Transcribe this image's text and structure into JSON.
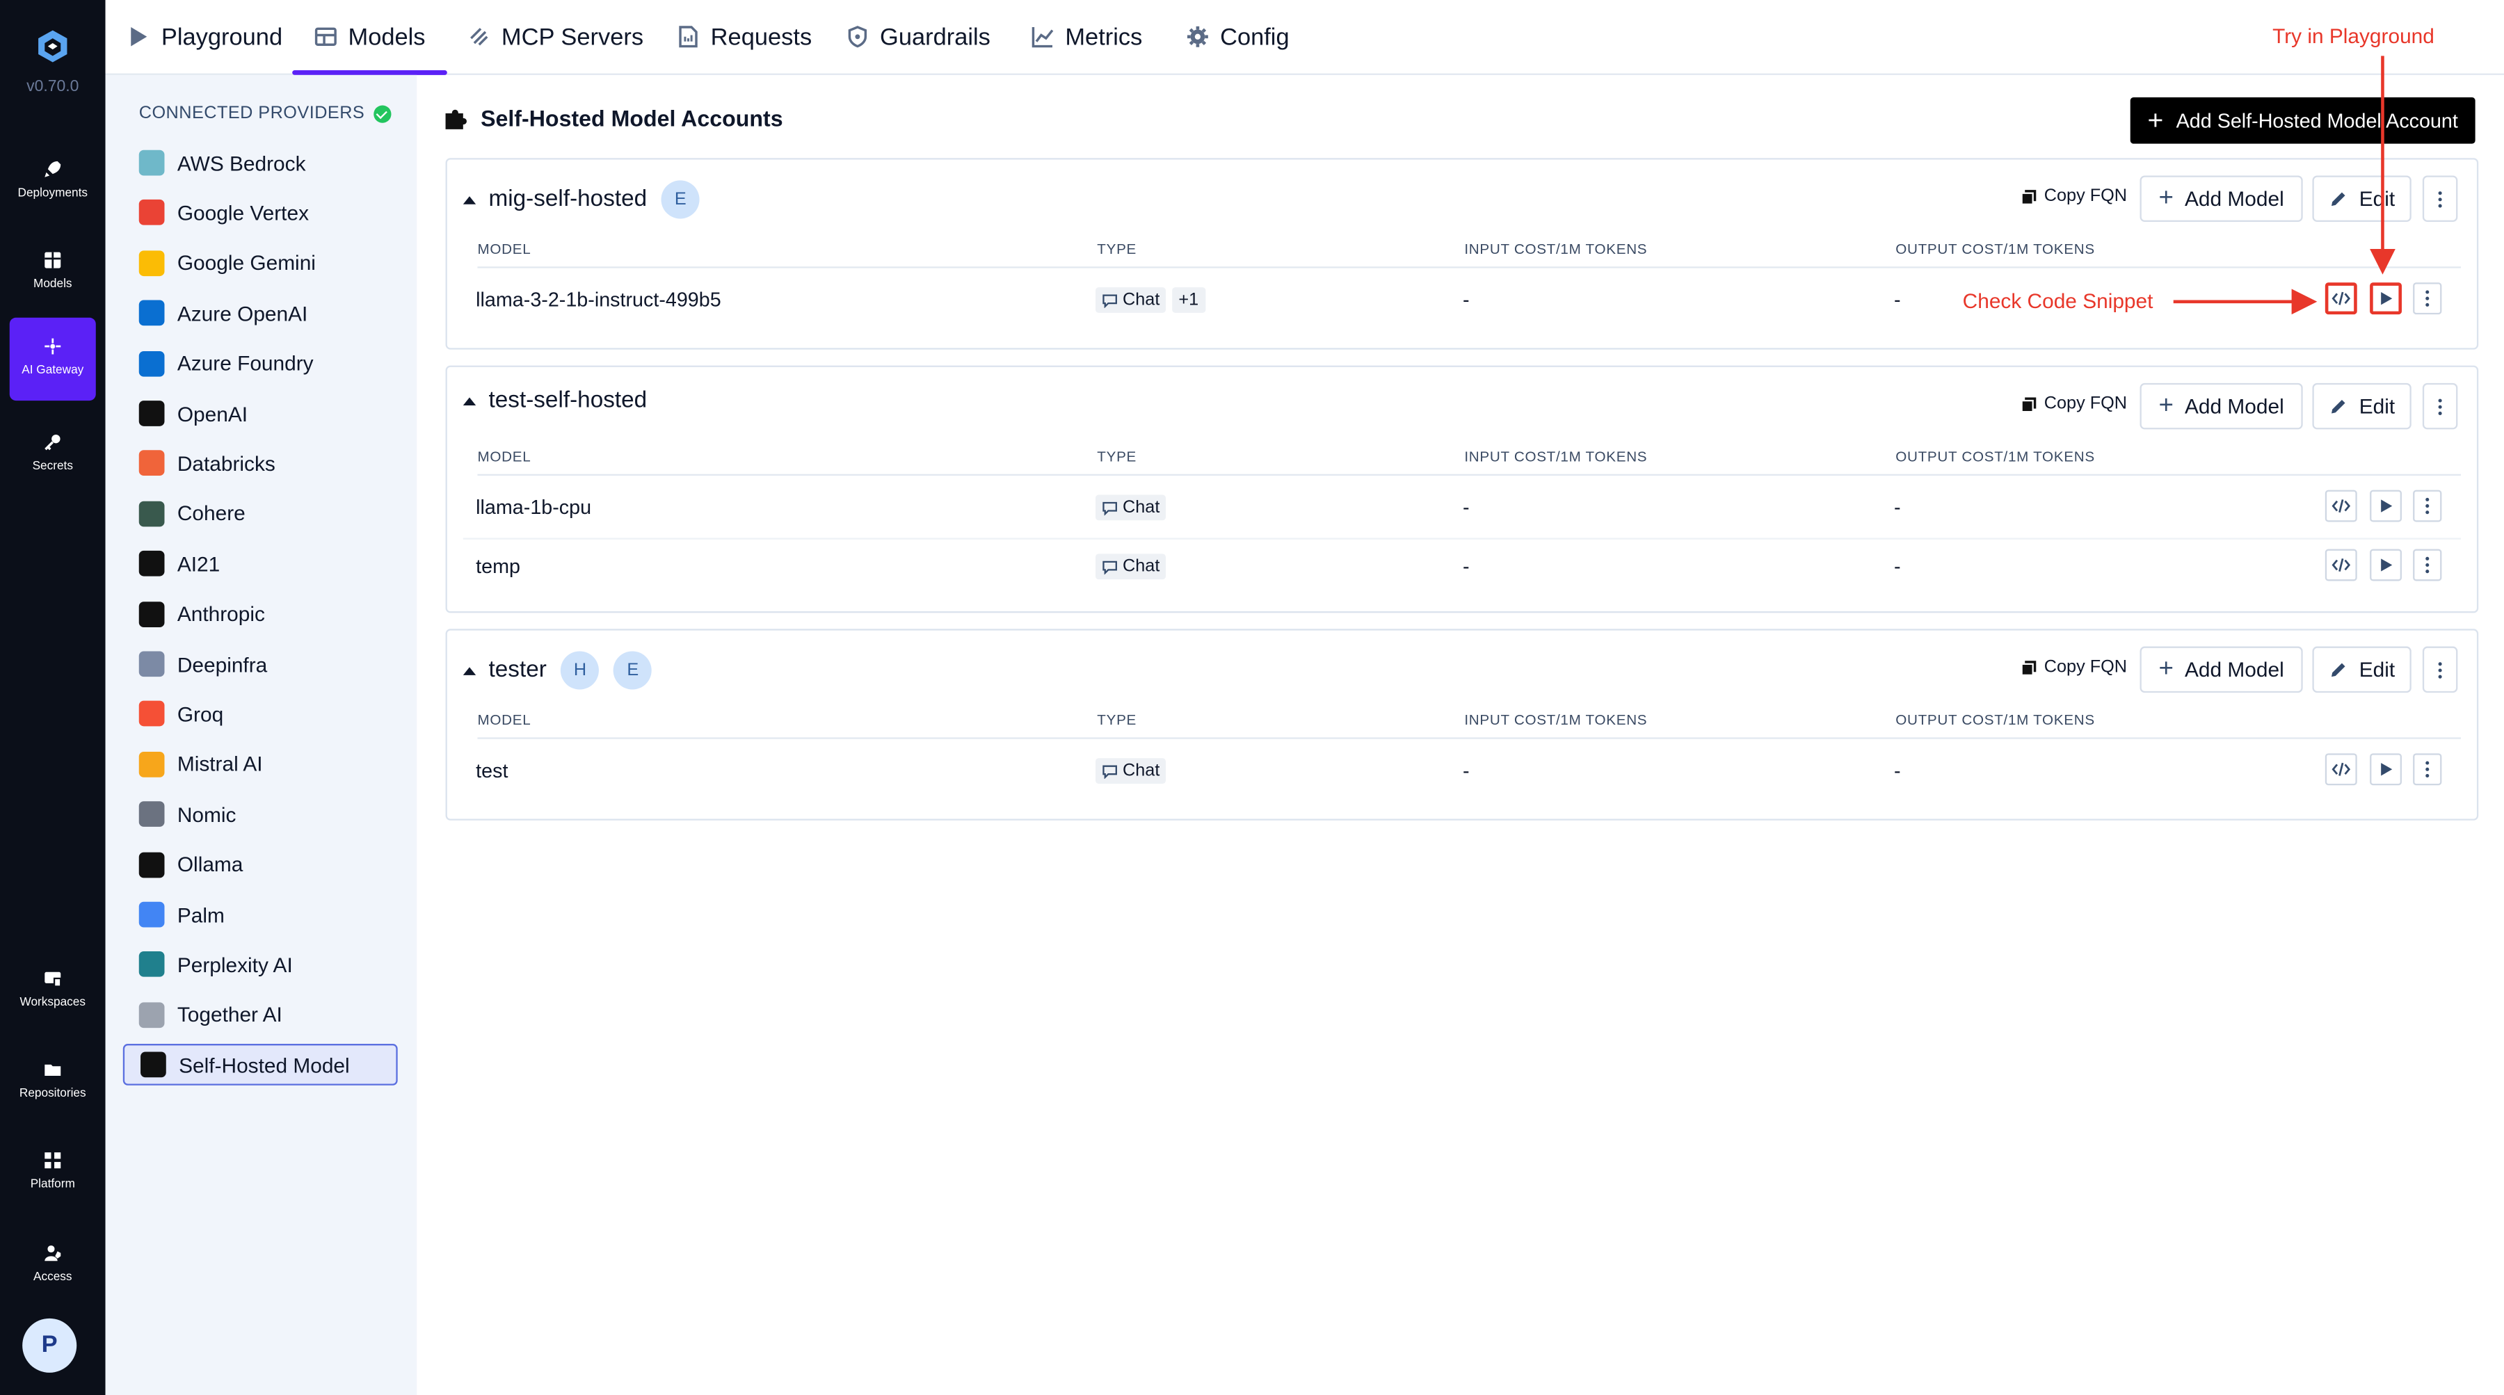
{
  "app": {
    "version": "v0.70.0"
  },
  "rail": [
    {
      "label": "Deployments",
      "icon": "rocket-icon"
    },
    {
      "label": "Models",
      "icon": "grid-icon"
    },
    {
      "label": "AI Gateway",
      "icon": "gateway-icon",
      "active": true
    },
    {
      "label": "Secrets",
      "icon": "key-icon"
    },
    {
      "label": "Workspaces",
      "icon": "workspaces-icon"
    },
    {
      "label": "Repositories",
      "icon": "folder-icon"
    },
    {
      "label": "Platform",
      "icon": "apps-icon"
    },
    {
      "label": "Access",
      "icon": "user-shield-icon"
    }
  ],
  "user": {
    "initial": "P"
  },
  "topnav": [
    {
      "label": "Playground",
      "icon": "play-icon"
    },
    {
      "label": "Models",
      "icon": "table-icon",
      "active": true
    },
    {
      "label": "MCP Servers",
      "icon": "mcp-icon"
    },
    {
      "label": "Requests",
      "icon": "document-icon"
    },
    {
      "label": "Guardrails",
      "icon": "shield-icon"
    },
    {
      "label": "Metrics",
      "icon": "chart-icon"
    },
    {
      "label": "Config",
      "icon": "gear-icon"
    }
  ],
  "providers": {
    "heading": "CONNECTED PROVIDERS",
    "items": [
      {
        "label": "AWS Bedrock",
        "color": "#6fb8c9"
      },
      {
        "label": "Google Vertex",
        "color": "#ea4335"
      },
      {
        "label": "Google Gemini",
        "color": "#fbbc05"
      },
      {
        "label": "Azure OpenAI",
        "color": "#0a6fd1"
      },
      {
        "label": "Azure Foundry",
        "color": "#0a6fd1"
      },
      {
        "label": "OpenAI",
        "color": "#111111"
      },
      {
        "label": "Databricks",
        "color": "#f0643a"
      },
      {
        "label": "Cohere",
        "color": "#39594d"
      },
      {
        "label": "AI21",
        "color": "#111111"
      },
      {
        "label": "Anthropic",
        "color": "#111111"
      },
      {
        "label": "Deepinfra",
        "color": "#7c8aa5"
      },
      {
        "label": "Groq",
        "color": "#f55036"
      },
      {
        "label": "Mistral AI",
        "color": "#f7a61b"
      },
      {
        "label": "Nomic",
        "color": "#6b7280"
      },
      {
        "label": "Ollama",
        "color": "#111111"
      },
      {
        "label": "Palm",
        "color": "#4285f4"
      },
      {
        "label": "Perplexity AI",
        "color": "#20808d"
      },
      {
        "label": "Together AI",
        "color": "#9ca3af"
      },
      {
        "label": "Self-Hosted Model",
        "color": "#111111",
        "active": true
      }
    ]
  },
  "main": {
    "title": "Self-Hosted Model Accounts",
    "add_button": "Add Self-Hosted Model Account",
    "columns": [
      "MODEL",
      "TYPE",
      "INPUT COST/1M TOKENS",
      "OUTPUT COST/1M TOKENS"
    ],
    "copy_fqn": "Copy FQN",
    "add_model": "Add Model",
    "edit": "Edit",
    "accounts": [
      {
        "name": "mig-self-hosted",
        "badges": [
          "E"
        ],
        "models": [
          {
            "model": "llama-3-2-1b-instruct-499b5",
            "type": "Chat",
            "extra": "+1",
            "input_cost": "-",
            "output_cost": "-"
          }
        ]
      },
      {
        "name": "test-self-hosted",
        "badges": [],
        "models": [
          {
            "model": "llama-1b-cpu",
            "type": "Chat",
            "input_cost": "-",
            "output_cost": "-"
          },
          {
            "model": "temp",
            "type": "Chat",
            "input_cost": "-",
            "output_cost": "-"
          }
        ]
      },
      {
        "name": "tester",
        "badges": [
          "H",
          "E"
        ],
        "models": [
          {
            "model": "test",
            "type": "Chat",
            "input_cost": "-",
            "output_cost": "-"
          }
        ]
      }
    ]
  },
  "annotations": {
    "try_playground": "Try in Playground",
    "check_code": "Check Code Snippet",
    "color": "#e8372a"
  }
}
